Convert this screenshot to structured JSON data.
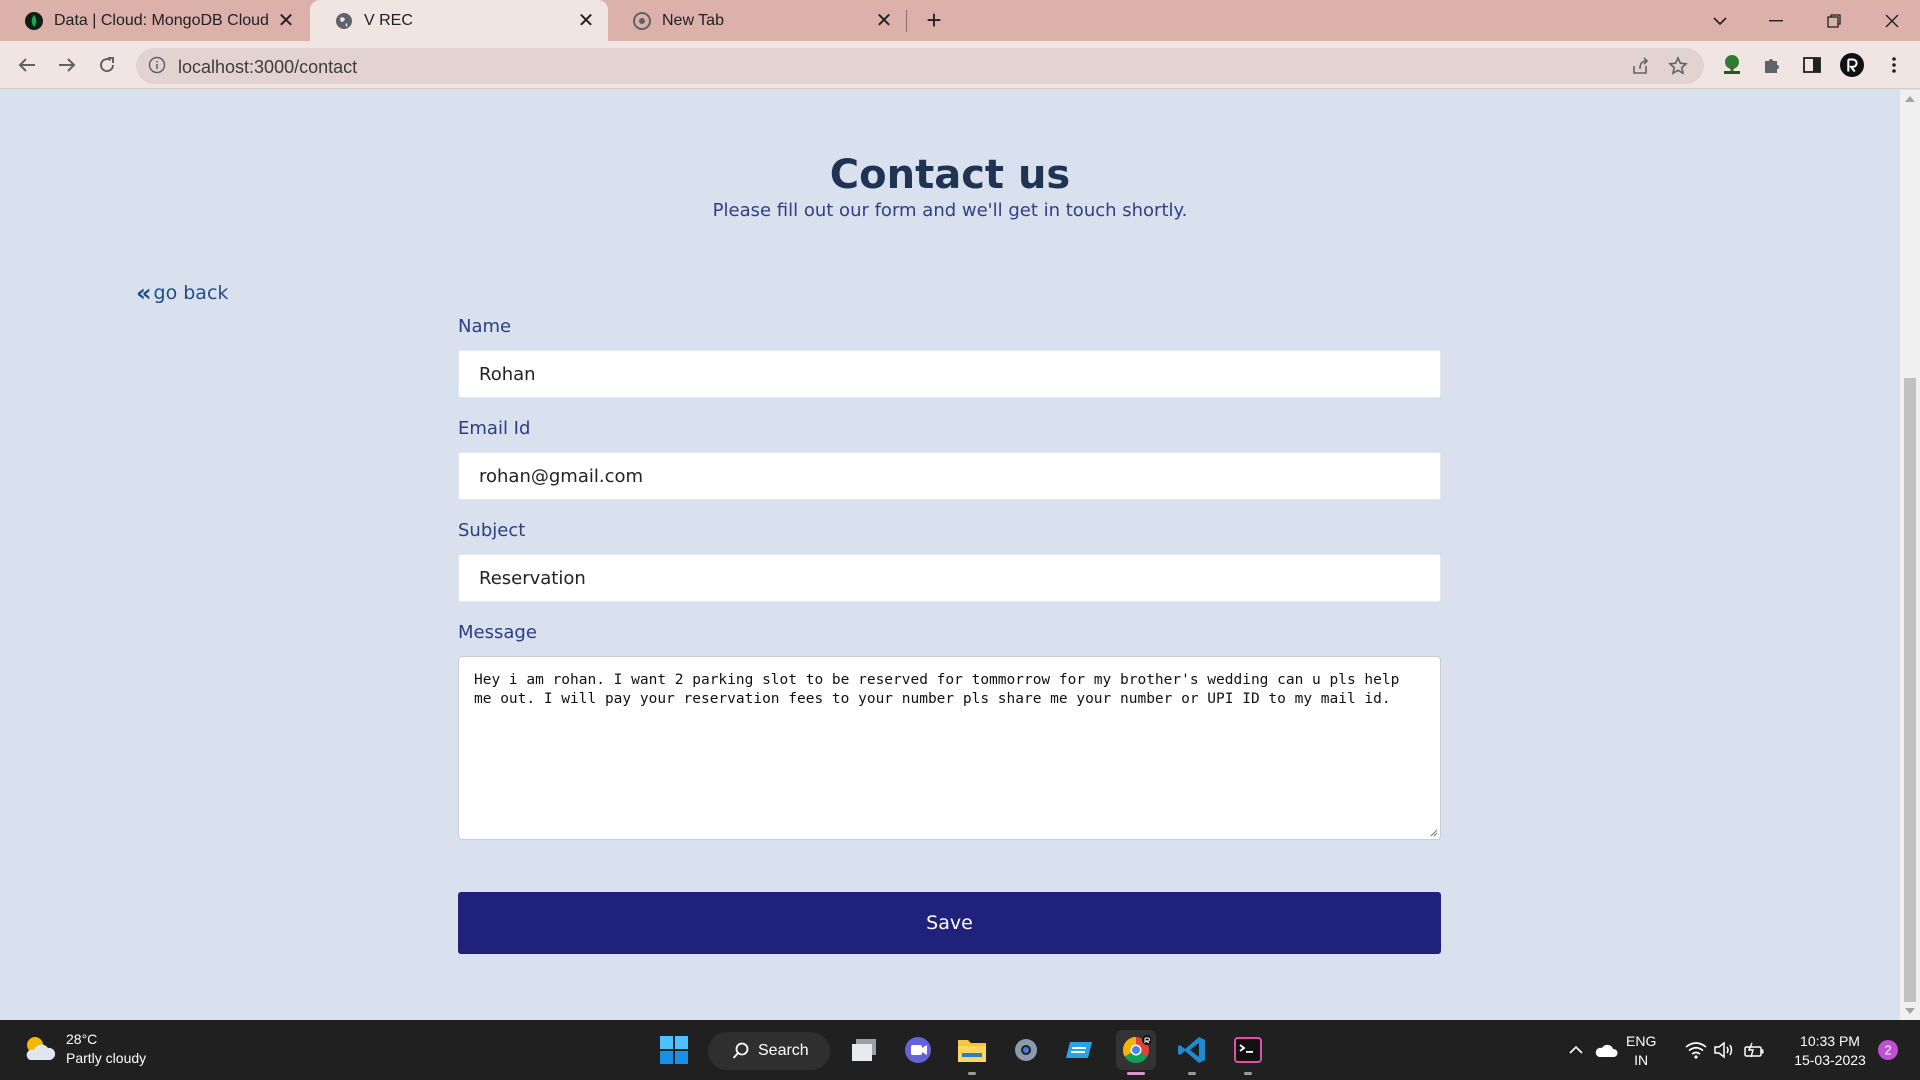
{
  "browser": {
    "tabs": [
      {
        "title": "Data | Cloud: MongoDB Cloud",
        "icon": "mongodb-leaf-icon",
        "active": false
      },
      {
        "title": "V REC",
        "icon": "globe-icon",
        "active": true
      },
      {
        "title": "New Tab",
        "icon": "chrome-icon",
        "active": false
      }
    ],
    "url": "localhost:3000/contact",
    "colors": {
      "tabbar": "#dbb1a9",
      "toolbar": "#f1e5e3"
    }
  },
  "page": {
    "title": "Contact us",
    "subtitle": "Please fill out our form and we'll get in touch shortly.",
    "go_back": "go back",
    "form": {
      "name_label": "Name",
      "name_value": "Rohan",
      "email_label": "Email Id",
      "email_value": "rohan@gmail.com",
      "subject_label": "Subject",
      "subject_value": "Reservation",
      "message_label": "Message",
      "message_value": "Hey i am rohan. I want 2 parking slot to be reserved for tommorrow for my brother's wedding can u pls help me out. I will pay your reservation fees to your number pls share me your number or UPI ID to my mail id.",
      "save_label": "Save"
    },
    "colors": {
      "background": "#d9e0ee",
      "button": "#1f217a",
      "heading": "#1f3352"
    }
  },
  "taskbar": {
    "weather": {
      "temp": "28°C",
      "condition": "Partly cloudy"
    },
    "search_label": "Search",
    "language": {
      "line1": "ENG",
      "line2": "IN"
    },
    "time": "10:33 PM",
    "date": "15-03-2023",
    "notification_count": "2"
  }
}
